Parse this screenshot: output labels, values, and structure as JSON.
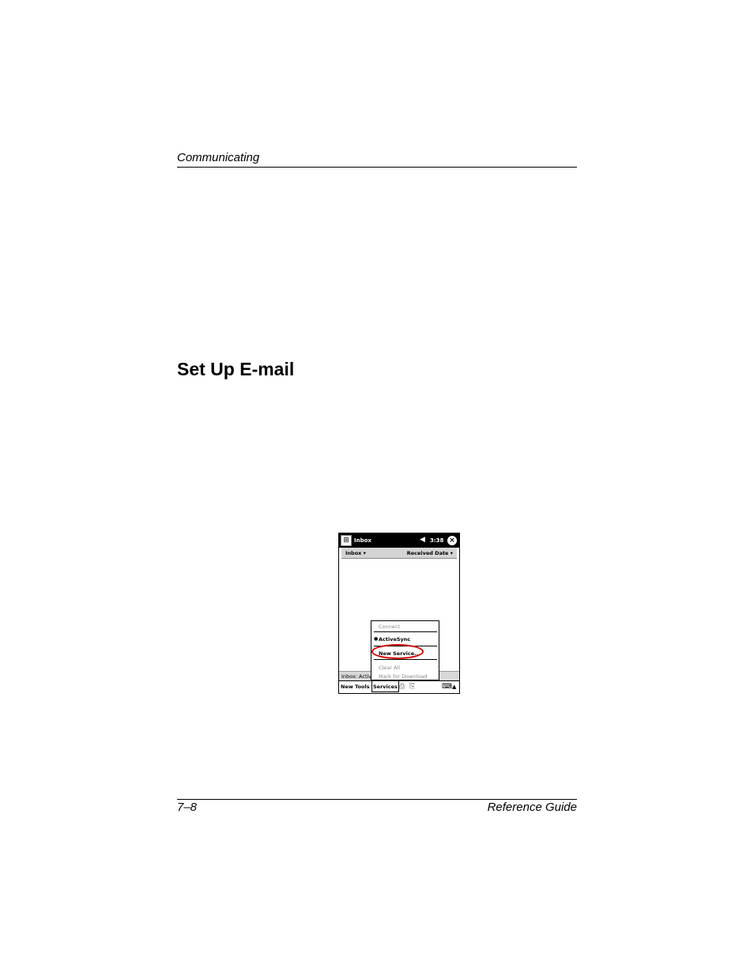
{
  "page": {
    "running_header": "Communicating",
    "section_title": "Set Up E-mail",
    "footer_left": "7–8",
    "footer_right": "Reference Guide"
  },
  "device": {
    "titlebar": {
      "title": "Inbox",
      "time": "3:38"
    },
    "filter_bar": {
      "folder": "Inbox ▾",
      "sort": "Received Date ▾"
    },
    "status_text": "Inbox: Activ",
    "menu_bar": {
      "new": "New",
      "tools": "Tools",
      "services": "Services"
    },
    "services_menu": {
      "connect": "Connect",
      "activesync": "ActiveSync",
      "new_service": "New Service...",
      "clear_all": "Clear All",
      "mark_for_download": "Mark for Download"
    },
    "highlight_color": "#d40000"
  }
}
